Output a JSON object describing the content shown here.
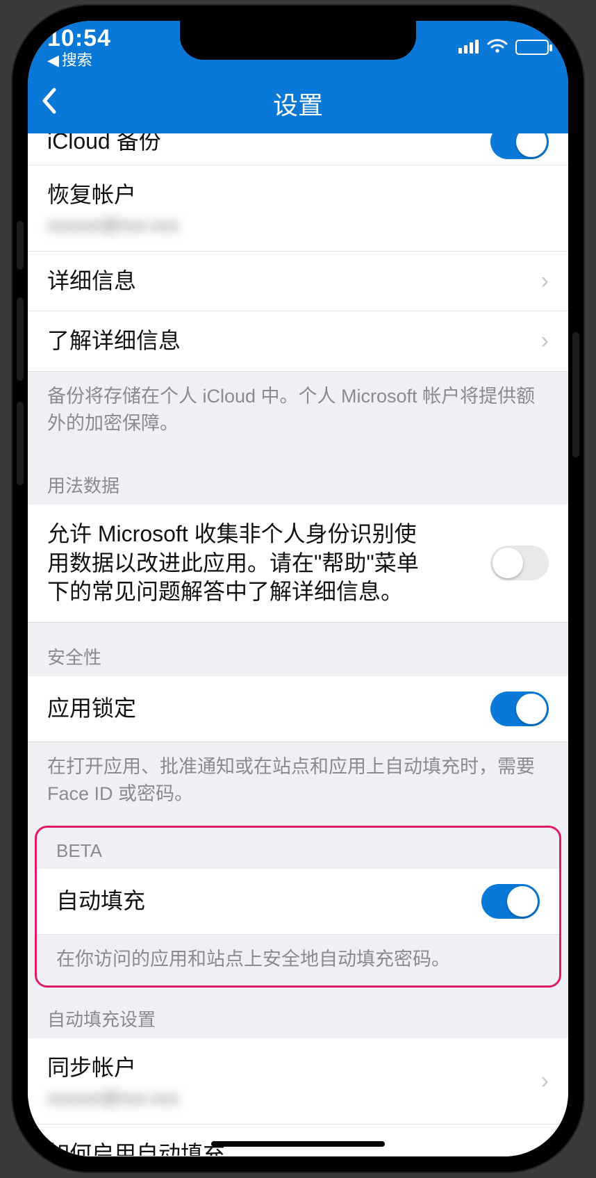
{
  "status": {
    "time": "10:54",
    "back_search_label": "搜索",
    "signal_glyph": "▮▮▮▮",
    "wifi_glyph": "􀙇"
  },
  "nav": {
    "title": "设置",
    "back_glyph": "‹"
  },
  "rows": {
    "icloud_backup_label": "iCloud 备份",
    "restore_account_label": "恢复帐户",
    "restore_account_value": "xxxxxx@xxx.xxx",
    "details_label": "详细信息",
    "learn_more_label": "了解详细信息"
  },
  "footers": {
    "backup_note": "备份将存储在个人 iCloud 中。个人 Microsoft 帐户将提供额外的加密保障。",
    "app_lock_note": "在打开应用、批准通知或在站点和应用上自动填充时，需要 Face ID 或密码。",
    "autofill_note": "在你访问的应用和站点上安全地自动填充密码。"
  },
  "headers": {
    "usage_data": "用法数据",
    "security": "安全性",
    "beta": "BETA",
    "autofill_settings": "自动填充设置"
  },
  "usage": {
    "allow_text": "允许 Microsoft 收集非个人身份识别使用数据以改进此应用。请在\"帮助\"菜单下的常见问题解答中了解详细信息。"
  },
  "security": {
    "app_lock_label": "应用锁定"
  },
  "beta": {
    "autofill_label": "自动填充"
  },
  "autofill_settings": {
    "sync_account_label": "同步帐户",
    "sync_account_value": "xxxxxx@xxx.xxx",
    "how_enable_label": "如何启用自动填充"
  },
  "toggles": {
    "icloud_backup": true,
    "usage_data": false,
    "app_lock": true,
    "autofill": true
  }
}
